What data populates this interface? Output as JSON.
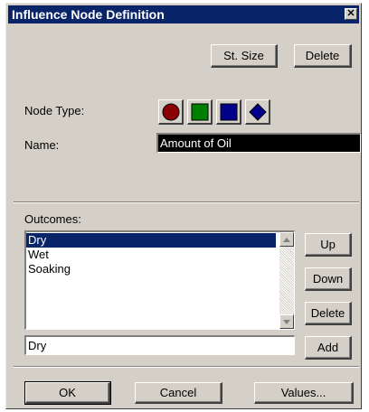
{
  "window": {
    "title": "Influence Node Definition",
    "close_glyph": "✕"
  },
  "header_buttons": {
    "st_size": "St. Size",
    "delete": "Delete"
  },
  "node_type": {
    "label": "Node Type:",
    "types": [
      {
        "name": "chance",
        "shape": "circle",
        "color": "#8b0000"
      },
      {
        "name": "decision",
        "shape": "square",
        "color": "#008000"
      },
      {
        "name": "value",
        "shape": "square",
        "color": "#00008b"
      },
      {
        "name": "deterministic",
        "shape": "diamond",
        "color": "#00008b"
      }
    ]
  },
  "name_field": {
    "label": "Name:",
    "value": "Amount of Oil"
  },
  "outcomes": {
    "label": "Outcomes:",
    "items": [
      "Dry",
      "Wet",
      "Soaking"
    ],
    "selected_index": 0,
    "edit_value": "Dry",
    "buttons": {
      "up": "Up",
      "down": "Down",
      "delete": "Delete",
      "add": "Add"
    }
  },
  "footer_buttons": {
    "ok": "OK",
    "cancel": "Cancel",
    "values": "Values..."
  },
  "icons": {
    "scroll_up": "scroll-up-arrow-icon",
    "scroll_down": "scroll-down-arrow-icon"
  }
}
